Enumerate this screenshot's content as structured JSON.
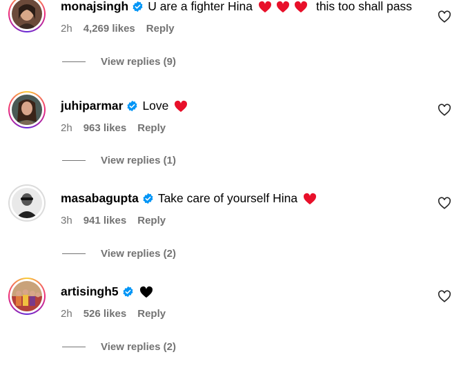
{
  "comments": [
    {
      "username": "monajsingh",
      "text": "U are a fighter Hina",
      "emoji_after": [
        "red-heart",
        "red-heart",
        "red-heart"
      ],
      "text2": "this too shall pass",
      "time": "2h",
      "likes": "4,269 likes",
      "reply": "Reply",
      "view_replies": "View replies (9)",
      "ring": "gradient"
    },
    {
      "username": "juhiparmar",
      "text": "Love",
      "emoji_after": [
        "red-heart"
      ],
      "text2": "",
      "time": "2h",
      "likes": "963 likes",
      "reply": "Reply",
      "view_replies": "View replies (1)",
      "ring": "gradient"
    },
    {
      "username": "masabagupta",
      "text": "Take care of yourself Hina",
      "emoji_after": [
        "red-heart"
      ],
      "text2": "",
      "time": "3h",
      "likes": "941 likes",
      "reply": "Reply",
      "view_replies": "View replies (2)",
      "ring": "plain"
    },
    {
      "username": "artisingh5",
      "text": "",
      "emoji_after": [
        "black-heart"
      ],
      "text2": "",
      "time": "2h",
      "likes": "526 likes",
      "reply": "Reply",
      "view_replies": "View replies (2)",
      "ring": "gradient"
    }
  ],
  "colors": {
    "verified_blue": "#0095f6",
    "heart_red": "#ff3040",
    "meta_gray": "#737373"
  }
}
